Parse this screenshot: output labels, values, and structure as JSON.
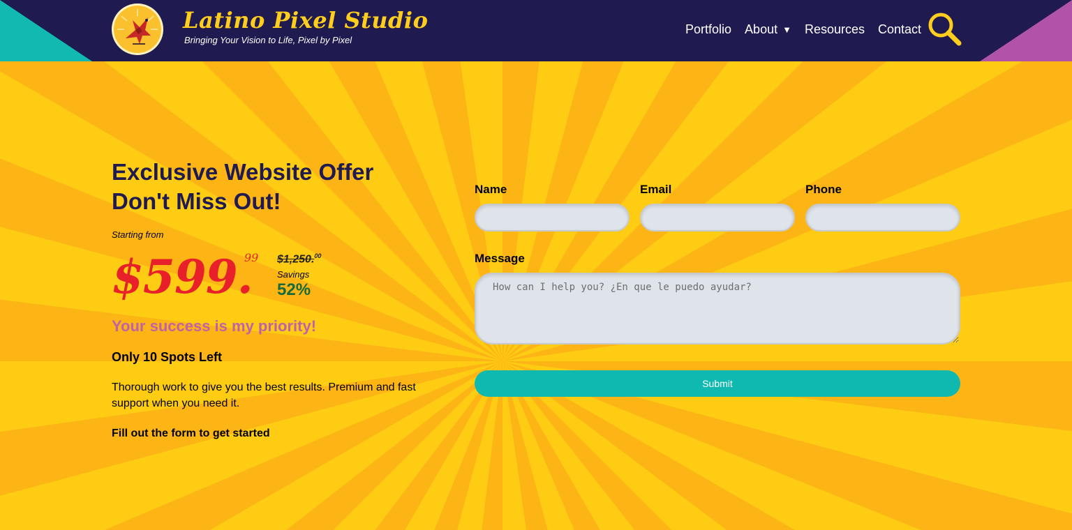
{
  "header": {
    "brand_title": "Latino Pixel Studio",
    "brand_tagline": "Bringing Your Vision to Life, Pixel by Pixel",
    "logo_icon": "firebird-logo-icon",
    "nav": [
      {
        "label": "Portfolio"
      },
      {
        "label": "About",
        "caret": "▼"
      },
      {
        "label": "Resources"
      },
      {
        "label": "Contact"
      }
    ],
    "search_icon": "search-icon"
  },
  "offer": {
    "headline_line1": "Exclusive Website Offer",
    "headline_line2": "Don't Miss Out!",
    "starting_from": "Starting from",
    "price": "$599.",
    "price_cents": "99",
    "old_price": "$1,250.",
    "old_price_cents": "00",
    "savings_label": "Savings",
    "savings_value": "52%",
    "priority": "Your success is my priority!",
    "spots": "Only 10 Spots Left",
    "description": "Thorough work to give you the best results. Premium and fast support when you need it.",
    "cta": "Fill out the form to get started"
  },
  "form": {
    "name_label": "Name",
    "email_label": "Email",
    "phone_label": "Phone",
    "message_label": "Message",
    "message_placeholder": "How can I help you? ¿En que le puedo ayudar?",
    "submit_label": "Submit"
  },
  "colors": {
    "header_bg": "#1f1a4f",
    "brand_yellow": "#ffcd1e",
    "teal": "#10b9af",
    "purple": "#b154a9",
    "price_red": "#e8202a",
    "savings_green": "#186a3b",
    "priority_pink": "#c062a4"
  }
}
